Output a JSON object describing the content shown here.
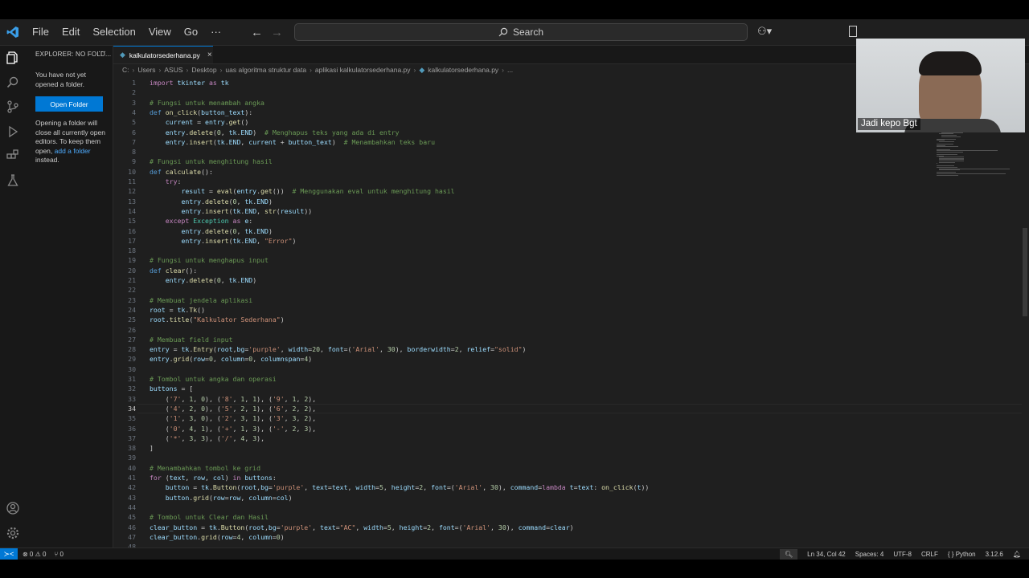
{
  "menu": [
    "File",
    "Edit",
    "Selection",
    "View",
    "Go",
    "···"
  ],
  "search": {
    "label": "Search"
  },
  "sidebar": {
    "header": "EXPLORER: NO FOLD...",
    "more": "···",
    "message1": "You have not yet opened a folder.",
    "open_folder": "Open Folder",
    "message2_pre": "Opening a folder will close all currently open editors. To keep them open, ",
    "message2_link": "add a folder",
    "message2_post": " instead."
  },
  "tab": {
    "label": "kalkulatorsederhana.py",
    "close": "×"
  },
  "breadcrumb": [
    "C:",
    "Users",
    "ASUS",
    "Desktop",
    "uas algoritma struktur data",
    "aplikasi kalkulatorsederhana.py",
    "kalkulatorsederhana.py",
    "..."
  ],
  "editor": {
    "active_line": 34,
    "lines": [
      {
        "n": "1",
        "t": "import tkinter as tk"
      },
      {
        "n": "2",
        "t": ""
      },
      {
        "n": "3",
        "t": "# Fungsi untuk menambah angka"
      },
      {
        "n": "4",
        "t": "def on_click(button_text):"
      },
      {
        "n": "5",
        "t": "    current = entry.get()"
      },
      {
        "n": "6",
        "t": "    entry.delete(0, tk.END)  # Menghapus teks yang ada di entry"
      },
      {
        "n": "7",
        "t": "    entry.insert(tk.END, current + button_text)  # Menambahkan teks baru"
      },
      {
        "n": "8",
        "t": ""
      },
      {
        "n": "9",
        "t": "# Fungsi untuk menghitung hasil"
      },
      {
        "n": "10",
        "t": "def calculate():"
      },
      {
        "n": "11",
        "t": "    try:"
      },
      {
        "n": "12",
        "t": "        result = eval(entry.get())  # Menggunakan eval untuk menghitung hasil"
      },
      {
        "n": "13",
        "t": "        entry.delete(0, tk.END)"
      },
      {
        "n": "14",
        "t": "        entry.insert(tk.END, str(result))"
      },
      {
        "n": "15",
        "t": "    except Exception as e:"
      },
      {
        "n": "16",
        "t": "        entry.delete(0, tk.END)"
      },
      {
        "n": "17",
        "t": "        entry.insert(tk.END, \"Error\")"
      },
      {
        "n": "18",
        "t": ""
      },
      {
        "n": "19",
        "t": "# Fungsi untuk menghapus input"
      },
      {
        "n": "20",
        "t": "def clear():"
      },
      {
        "n": "21",
        "t": "    entry.delete(0, tk.END)"
      },
      {
        "n": "22",
        "t": ""
      },
      {
        "n": "23",
        "t": "# Membuat jendela aplikasi"
      },
      {
        "n": "24",
        "t": "root = tk.Tk()"
      },
      {
        "n": "25",
        "t": "root.title(\"Kalkulator Sederhana\")"
      },
      {
        "n": "26",
        "t": ""
      },
      {
        "n": "27",
        "t": "# Membuat field input"
      },
      {
        "n": "28",
        "t": "entry = tk.Entry(root,bg='purple', width=20, font=('Arial', 30), borderwidth=2, relief=\"solid\")"
      },
      {
        "n": "29",
        "t": "entry.grid(row=0, column=0, columnspan=4)"
      },
      {
        "n": "30",
        "t": ""
      },
      {
        "n": "31",
        "t": "# Tombol untuk angka dan operasi"
      },
      {
        "n": "32",
        "t": "buttons = ["
      },
      {
        "n": "33",
        "t": "    ('7', 1, 0), ('8', 1, 1), ('9', 1, 2),"
      },
      {
        "n": "34",
        "t": "    ('4', 2, 0), ('5', 2, 1), ('6', 2, 2),"
      },
      {
        "n": "35",
        "t": "    ('1', 3, 0), ('2', 3, 1), ('3', 3, 2),"
      },
      {
        "n": "36",
        "t": "    ('0', 4, 1), ('+', 1, 3), ('-', 2, 3),"
      },
      {
        "n": "37",
        "t": "    ('*', 3, 3), ('/', 4, 3),"
      },
      {
        "n": "38",
        "t": "]"
      },
      {
        "n": "39",
        "t": ""
      },
      {
        "n": "40",
        "t": "# Menambahkan tombol ke grid"
      },
      {
        "n": "41",
        "t": "for (text, row, col) in buttons:"
      },
      {
        "n": "42",
        "t": "    button = tk.Button(root,bg='purple', text=text, width=5, height=2, font=('Arial', 30), command=lambda t=text: on_click(t))"
      },
      {
        "n": "43",
        "t": "    button.grid(row=row, column=col)"
      },
      {
        "n": "44",
        "t": ""
      },
      {
        "n": "45",
        "t": "# Tombol untuk Clear dan Hasil"
      },
      {
        "n": "46",
        "t": "clear_button = tk.Button(root,bg='purple', text=\"AC\", width=5, height=2, font=('Arial', 30), command=clear)"
      },
      {
        "n": "47",
        "t": "clear_button.grid(row=4, column=0)"
      },
      {
        "n": "48",
        "t": ""
      }
    ]
  },
  "webcam": {
    "label": "Jadi kepo Bgt"
  },
  "status": {
    "errors": "⊗ 0 ⚠ 0",
    "ports": "⑂ 0",
    "position": "Ln 34, Col 42",
    "spaces": "Spaces: 4",
    "encoding": "UTF-8",
    "eol": "CRLF",
    "language": "Python",
    "version": "3.12.6"
  },
  "colors": {
    "accent": "#0078d4",
    "keyword": "#c586c0",
    "def_keyword": "#569cd6",
    "function": "#dcdcaa",
    "variable": "#9cdcfe",
    "string": "#ce9178",
    "number": "#b5cea8",
    "comment": "#6a9955",
    "class": "#4ec9b0"
  }
}
